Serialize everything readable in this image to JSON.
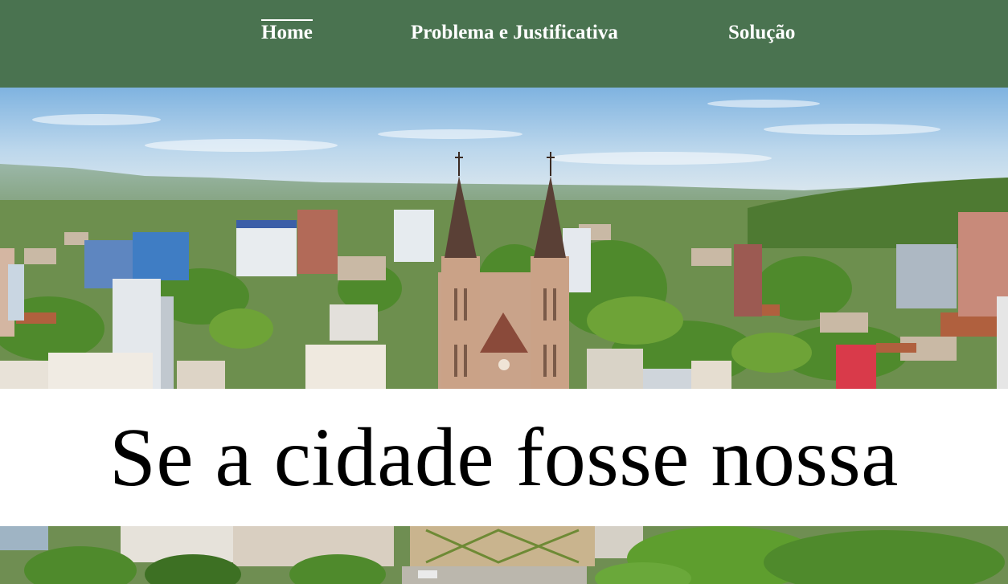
{
  "nav": {
    "items": [
      {
        "label": "Home",
        "active": true
      },
      {
        "label": "Problema e Justificativa",
        "active": false
      },
      {
        "label": "Solução",
        "active": false
      }
    ],
    "background_color": "#4a7350",
    "text_color": "#ffffff"
  },
  "hero": {
    "title": "Se a cidade fosse nossa"
  }
}
